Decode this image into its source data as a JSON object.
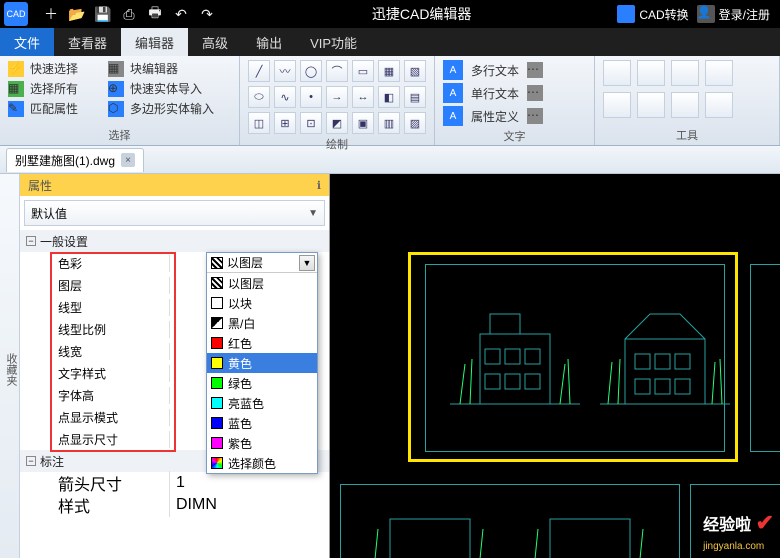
{
  "titlebar": {
    "app_icon_text": "CAD",
    "title": "迅捷CAD编辑器",
    "convert_label": "CAD转换",
    "login_label": "登录/注册"
  },
  "menu": {
    "file": "文件",
    "viewer": "查看器",
    "editor": "编辑器",
    "advanced": "高级",
    "output": "输出",
    "vip": "VIP功能"
  },
  "ribbon": {
    "select_group": {
      "quick_select": "快速选择",
      "block_editor": "块编辑器",
      "select_all": "选择所有",
      "quick_import": "快速实体导入",
      "match_prop": "匹配属性",
      "poly_input": "多边形实体输入",
      "label": "选择"
    },
    "draw_group": {
      "label": "绘制"
    },
    "text_group": {
      "mtext": "多行文本",
      "stext": "单行文本",
      "attr_def": "属性定义",
      "label": "文字"
    },
    "tool_group": {
      "label": "工具"
    }
  },
  "file_tab": {
    "name": "别墅建施图(1).dwg"
  },
  "favorites_label": "收藏夹",
  "properties": {
    "header": "属性",
    "pin": "ℹ",
    "default": "默认值",
    "section_general": "一般设置",
    "rows": {
      "color": "色彩",
      "layer": "图层",
      "linetype": "线型",
      "ltscale": "线型比例",
      "lineweight": "线宽",
      "textstyle": "文字样式",
      "textheight": "字体高",
      "pointstyle": "点显示模式",
      "pointsize": "点显示尺寸"
    },
    "section_annotation": "标注",
    "arrowsize_label": "箭头尺寸",
    "arrowsize_value": "1",
    "style_label": "样式",
    "style_value": "DIMN"
  },
  "color_dropdown": {
    "current": "以图层",
    "options": [
      {
        "key": "bylayer",
        "label": "以图层"
      },
      {
        "key": "byblock",
        "label": "以块"
      },
      {
        "key": "bw",
        "label": "黑/白"
      },
      {
        "key": "red",
        "label": "红色",
        "color": "#ff0000"
      },
      {
        "key": "yellow",
        "label": "黄色",
        "color": "#ffff00"
      },
      {
        "key": "green",
        "label": "绿色",
        "color": "#00ff00"
      },
      {
        "key": "cyan",
        "label": "亮蓝色",
        "color": "#00ffff"
      },
      {
        "key": "blue",
        "label": "蓝色",
        "color": "#0000ff"
      },
      {
        "key": "magenta",
        "label": "紫色",
        "color": "#ff00ff"
      },
      {
        "key": "choose",
        "label": "选择颜色"
      }
    ],
    "selected_index": 4
  },
  "watermark": {
    "main": "经验啦",
    "sub": "jingyanla.com"
  }
}
